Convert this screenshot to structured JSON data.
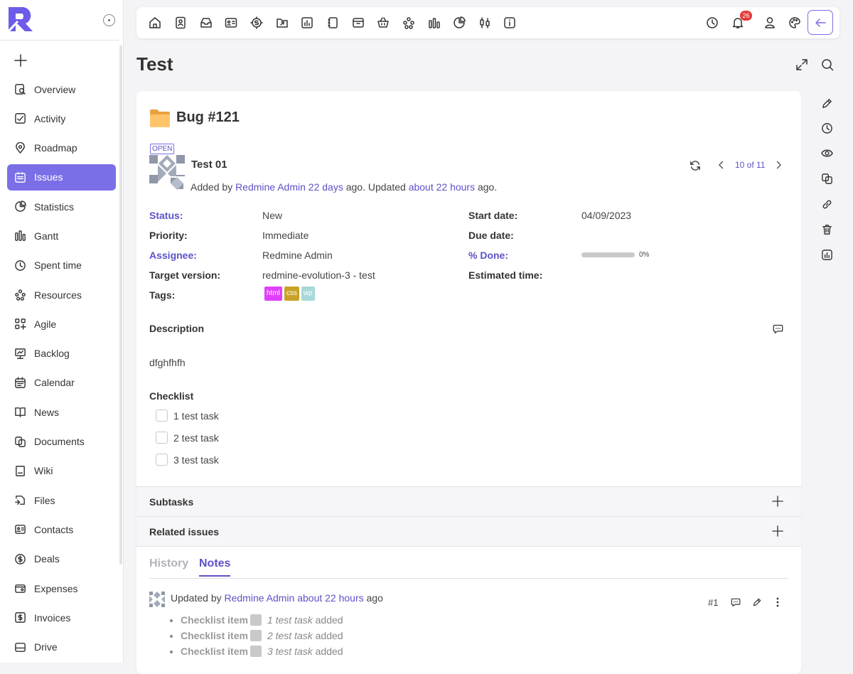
{
  "sidebar": {
    "items": [
      {
        "label": "Overview",
        "icon": "overview-icon"
      },
      {
        "label": "Activity",
        "icon": "activity-icon"
      },
      {
        "label": "Roadmap",
        "icon": "roadmap-icon"
      },
      {
        "label": "Issues",
        "icon": "issues-icon",
        "active": true
      },
      {
        "label": "Statistics",
        "icon": "statistics-icon"
      },
      {
        "label": "Gantt",
        "icon": "gantt-icon"
      },
      {
        "label": "Spent time",
        "icon": "clock-icon"
      },
      {
        "label": "Resources",
        "icon": "resources-icon"
      },
      {
        "label": "Agile",
        "icon": "agile-icon"
      },
      {
        "label": "Backlog",
        "icon": "backlog-icon"
      },
      {
        "label": "Calendar",
        "icon": "calendar-icon"
      },
      {
        "label": "News",
        "icon": "news-icon"
      },
      {
        "label": "Documents",
        "icon": "documents-icon"
      },
      {
        "label": "Wiki",
        "icon": "wiki-icon"
      },
      {
        "label": "Files",
        "icon": "files-icon"
      },
      {
        "label": "Contacts",
        "icon": "contacts-icon"
      },
      {
        "label": "Deals",
        "icon": "deals-icon"
      },
      {
        "label": "Expenses",
        "icon": "expenses-icon"
      },
      {
        "label": "Invoices",
        "icon": "invoices-icon"
      },
      {
        "label": "Drive",
        "icon": "drive-icon"
      }
    ]
  },
  "topbar": {
    "notification_count": "26",
    "accent": "#7b6fe8"
  },
  "page": {
    "title": "Test"
  },
  "issue": {
    "heading": "Bug #121",
    "status_tag": "OPEN",
    "subject": "Test 01",
    "added_prefix": "Added by",
    "author": "Redmine Admin",
    "created_ago": "22 days",
    "mid_text": "ago. Updated",
    "updated_ago": "about 22 hours",
    "end_text": "ago.",
    "pager": "10 of 11",
    "attributes": {
      "status_label": "Status:",
      "status_value": "New",
      "priority_label": "Priority:",
      "priority_value": "Immediate",
      "assignee_label": "Assignee:",
      "assignee_value": "Redmine Admin",
      "target_label": "Target version:",
      "target_value": "redmine-evolution-3 - test",
      "tags_label": "Tags:",
      "start_label": "Start date:",
      "start_value": "04/09/2023",
      "due_label": "Due date:",
      "done_label": "% Done:",
      "done_value": "0%",
      "done_fraction": 0,
      "estimated_label": "Estimated time:"
    },
    "tags": [
      {
        "label": "html",
        "color": "#e040fb"
      },
      {
        "label": "css",
        "color": "#c9a227"
      },
      {
        "label": "wp",
        "color": "#a8d8d8"
      }
    ],
    "description_title": "Description",
    "description": "dfghfhfh",
    "checklist_title": "Checklist",
    "checklist": [
      "1 test task",
      "2 test task",
      "3 test task"
    ],
    "subtasks_title": "Subtasks",
    "related_title": "Related issues"
  },
  "tabs": {
    "history": "History",
    "notes": "Notes"
  },
  "note": {
    "prefix": "Updated by",
    "author": "Redmine Admin",
    "ago": "about 22 hours",
    "suffix": "ago",
    "number": "#1",
    "details": [
      {
        "key": "Checklist item",
        "value": "1 test task",
        "action": "added"
      },
      {
        "key": "Checklist item",
        "value": "2 test task",
        "action": "added"
      },
      {
        "key": "Checklist item",
        "value": "3 test task",
        "action": "added"
      }
    ]
  }
}
